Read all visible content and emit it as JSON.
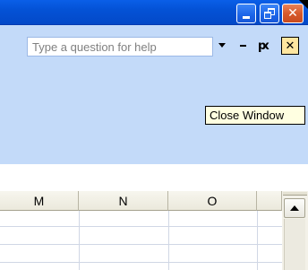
{
  "window": {
    "title_buttons": [
      "minimize",
      "restore",
      "close"
    ]
  },
  "menubar": {
    "help_placeholder": "Type a question for help",
    "tooltip": "Close Window",
    "doc_restore_glyph": "ԗ",
    "doc_close_glyph": "✕"
  },
  "sheet": {
    "columns": [
      "M",
      "N",
      "O"
    ]
  },
  "colors": {
    "titlebar": "#0452d6",
    "menu_background": "#c3daf9",
    "tooltip_background": "#ffffe1",
    "close_button": "#d75a2c"
  },
  "icons": {
    "minimize": "minimize-icon",
    "restore": "restore-icon",
    "close": "close-icon",
    "dropdown": "dropdown-arrow-icon",
    "scroll_up": "scroll-up-arrow-icon"
  }
}
